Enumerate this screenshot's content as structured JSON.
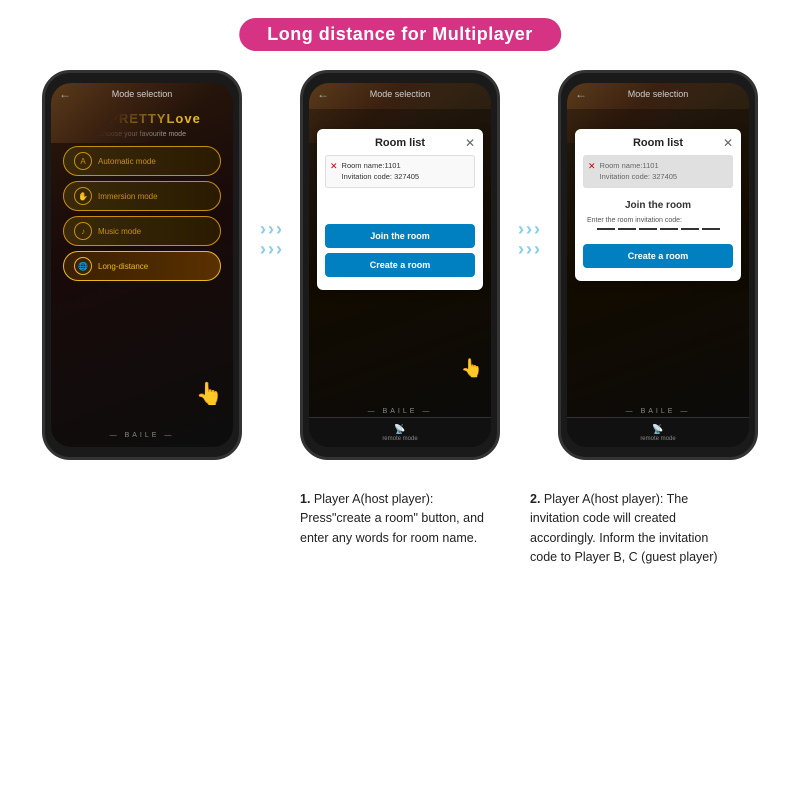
{
  "header": {
    "title": "Long distance for Multiplayer",
    "bg_color": "#d63384"
  },
  "phone1": {
    "topbar_label": "Mode selection",
    "logo_p": "P",
    "logo_text_pretty": "PRETTY",
    "logo_text_love": "Love",
    "subtitle": "Choose your favourite mode",
    "modes": [
      {
        "icon": "A",
        "label": "Automatic mode"
      },
      {
        "icon": "✋",
        "label": "Immersion mode"
      },
      {
        "icon": "♪",
        "label": "Music mode"
      },
      {
        "icon": "🌐",
        "label": "Long-distance",
        "active": true
      }
    ],
    "footer": "— BAILE —"
  },
  "phone2": {
    "topbar_label": "Mode selection",
    "modal_title": "Room list",
    "room_name": "Room name:1101",
    "invitation_code": "Invitation code: 327405",
    "btn_join": "Join the room",
    "btn_create": "Create a room",
    "remote_mode": "remote mode",
    "footer": "— BAILE —"
  },
  "phone3": {
    "topbar_label": "Mode selection",
    "modal_title": "Room list",
    "room_name": "Room name:1101",
    "invitation_code": "Invitation code: 327405",
    "join_title": "Join the room",
    "join_label": "Enter the room invitation code:",
    "btn_create": "Create a room",
    "remote_mode": "remote mode",
    "footer": "— BAILE —"
  },
  "desc1": {
    "step": "1.",
    "text": " Player A(host player): Press\"create a room\" button, and enter any words for room name."
  },
  "desc2": {
    "step": "2.",
    "text": " Player A(host player): The invitation code will created accordingly. Inform the invitation code to Player B, C (guest player)"
  }
}
